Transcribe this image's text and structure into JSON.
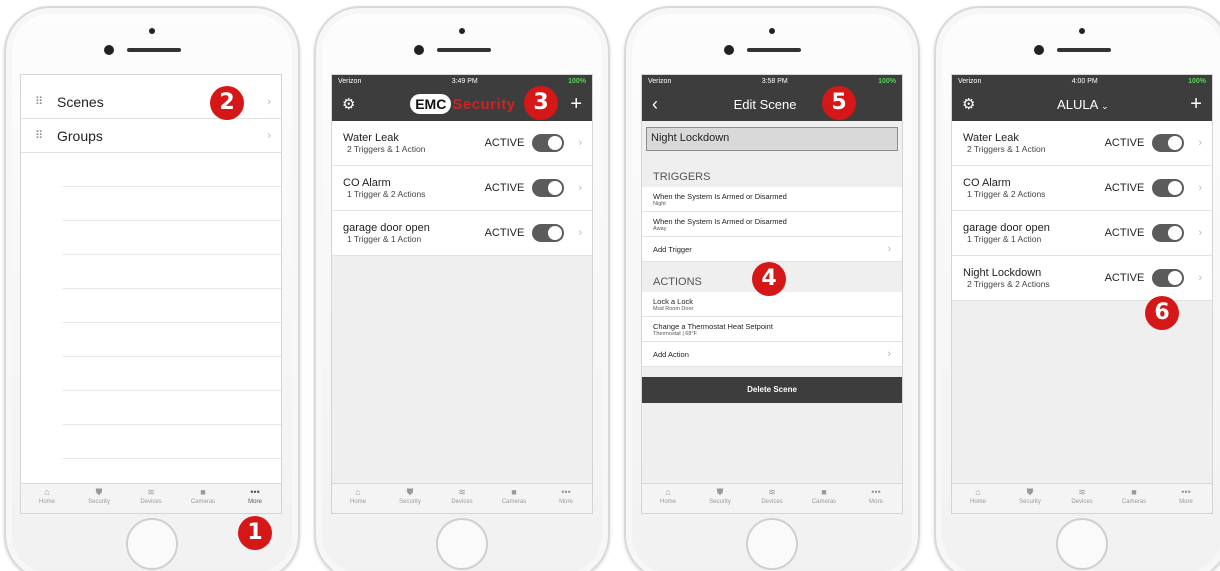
{
  "markers": [
    "1",
    "2",
    "3",
    "4",
    "5",
    "6"
  ],
  "tabbar": [
    "Home",
    "Security",
    "Devices",
    "Cameras",
    "More"
  ],
  "tab_icons": [
    "home-icon",
    "shield-icon",
    "wifi-icon",
    "camera-icon",
    "more-icon"
  ],
  "status": {
    "carrier": "Verizon",
    "times": [
      "3:49 PM",
      "3:58 PM",
      "4:00 PM"
    ],
    "battery": "100%"
  },
  "phone1": {
    "items": [
      {
        "label": "Scenes",
        "icon": "scenes-icon"
      },
      {
        "label": "Groups",
        "icon": "groups-icon"
      }
    ]
  },
  "phone2": {
    "logo_emc": "EMC",
    "logo_security": "Security",
    "scenes": [
      {
        "name": "Water Leak",
        "sub": "2 Triggers & 1 Action",
        "status": "ACTIVE"
      },
      {
        "name": "CO Alarm",
        "sub": "1 Trigger & 2 Actions",
        "status": "ACTIVE"
      },
      {
        "name": "garage door open",
        "sub": "1 Trigger & 1 Action",
        "status": "ACTIVE"
      }
    ]
  },
  "phone3": {
    "title": "Edit Scene",
    "scene_name": "Night Lockdown",
    "triggers_header": "TRIGGERS",
    "triggers": [
      {
        "main": "When the System Is Armed or Disarmed",
        "sub": "Night"
      },
      {
        "main": "When the System Is Armed or Disarmed",
        "sub": "Away"
      }
    ],
    "add_trigger": "Add Trigger",
    "actions_header": "ACTIONS",
    "actions": [
      {
        "main": "Lock a Lock",
        "sub": "Mud Room Door"
      },
      {
        "main": "Change a Thermostat Heat Setpoint",
        "sub": "Thermostat | 68°F"
      }
    ],
    "add_action": "Add Action",
    "delete_label": "Delete Scene"
  },
  "phone4": {
    "title": "ALULA",
    "scenes": [
      {
        "name": "Water Leak",
        "sub": "2 Triggers & 1 Action",
        "status": "ACTIVE"
      },
      {
        "name": "CO Alarm",
        "sub": "1 Trigger & 2 Actions",
        "status": "ACTIVE"
      },
      {
        "name": "garage door open",
        "sub": "1 Trigger & 1 Action",
        "status": "ACTIVE"
      },
      {
        "name": "Night Lockdown",
        "sub": "2 Triggers & 2 Actions",
        "status": "ACTIVE"
      }
    ]
  },
  "colors": {
    "accent": "#d61717",
    "navbar": "#3d3d3d"
  }
}
